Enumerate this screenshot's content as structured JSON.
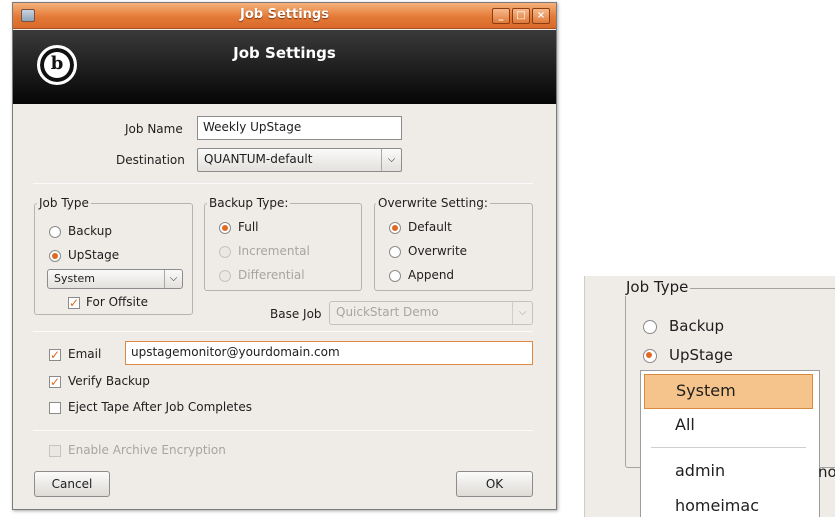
{
  "window": {
    "title": "Job Settings",
    "controls": [
      "_",
      "□",
      "×"
    ]
  },
  "header": {
    "title": "Job Settings",
    "logo_text": "b"
  },
  "form": {
    "job_name_label": "Job Name",
    "job_name_value": "Weekly UpStage",
    "destination_label": "Destination",
    "destination_value": "QUANTUM-default"
  },
  "job_type": {
    "title": "Job Type",
    "options": [
      "Backup",
      "UpStage"
    ],
    "selected": "UpStage",
    "combo_value": "System",
    "offsite_label": "For Offsite",
    "offsite_checked": true
  },
  "backup_type": {
    "title": "Backup Type:",
    "options": [
      "Full",
      "Incremental",
      "Differential"
    ],
    "selected": "Full"
  },
  "overwrite": {
    "title": "Overwrite Setting:",
    "options": [
      "Default",
      "Overwrite",
      "Append"
    ],
    "selected": "Default"
  },
  "base_job": {
    "label": "Base Job",
    "value": "QuickStart Demo"
  },
  "notify": {
    "email_label": "Email",
    "email_value": "upstagemonitor@yourdomain.com",
    "verify_label": "Verify Backup",
    "eject_label": "Eject Tape After Job Completes",
    "encryption_label": "Enable Archive Encryption"
  },
  "buttons": {
    "cancel": "Cancel",
    "ok": "OK"
  },
  "zoom": {
    "frame_title": "Job Type",
    "options": [
      "Backup",
      "UpStage"
    ],
    "menu_items": [
      "System",
      "All",
      "admin",
      "homeimac"
    ],
    "partial_text": "no"
  },
  "colors": {
    "accent": "#e06a22",
    "titlebar": "#e47a37",
    "highlight": "#f5c48c"
  }
}
